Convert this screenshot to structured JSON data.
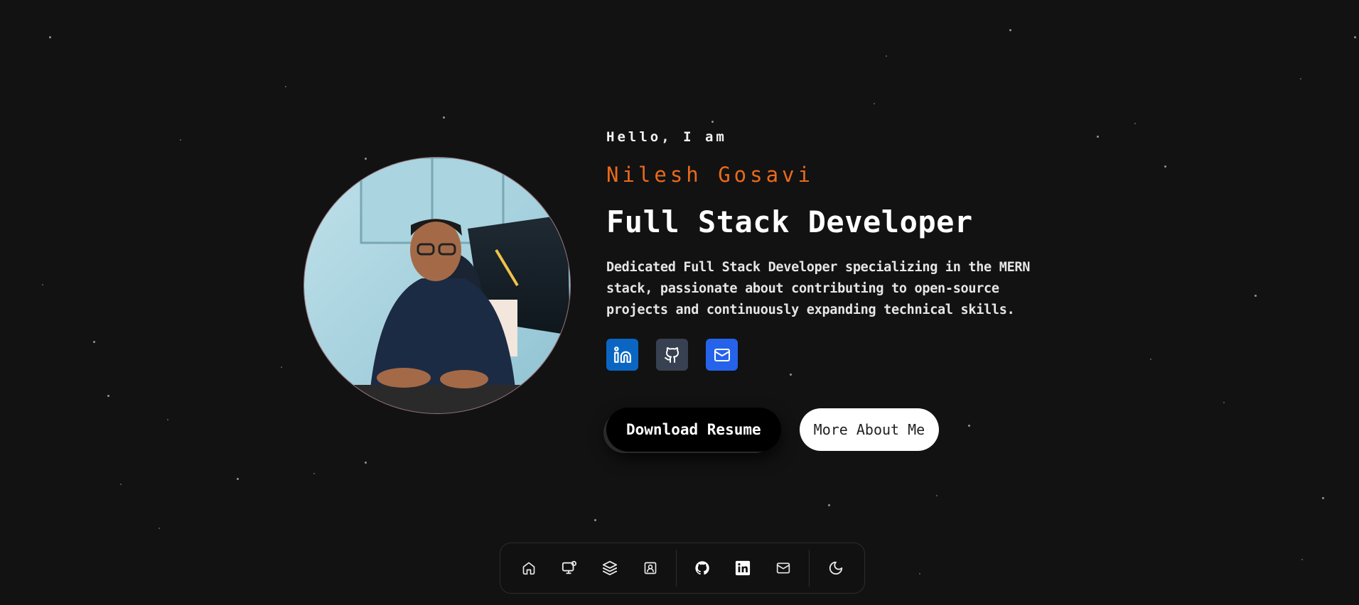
{
  "hero": {
    "greeting": "Hello, I am",
    "name": "Nilesh Gosavi",
    "role": "Full Stack Developer",
    "description": "Dedicated Full Stack Developer specializing in the MERN stack, passionate about contributing to open-source projects and continuously expanding technical skills."
  },
  "socials": [
    {
      "icon": "linkedin-icon",
      "color": "#0a66c2"
    },
    {
      "icon": "github-icon",
      "color": "#374151"
    },
    {
      "icon": "mail-icon",
      "color": "#2563eb"
    }
  ],
  "actions": {
    "download_resume": "Download Resume",
    "more_about": "More About Me"
  },
  "dock": {
    "items": [
      "home-icon",
      "monitor-icon",
      "layers-icon",
      "contact-icon",
      "github-icon",
      "linkedin-icon",
      "mail-icon",
      "moon-icon"
    ]
  },
  "colors": {
    "background": "#121212",
    "accent": "#ea6a1a"
  }
}
